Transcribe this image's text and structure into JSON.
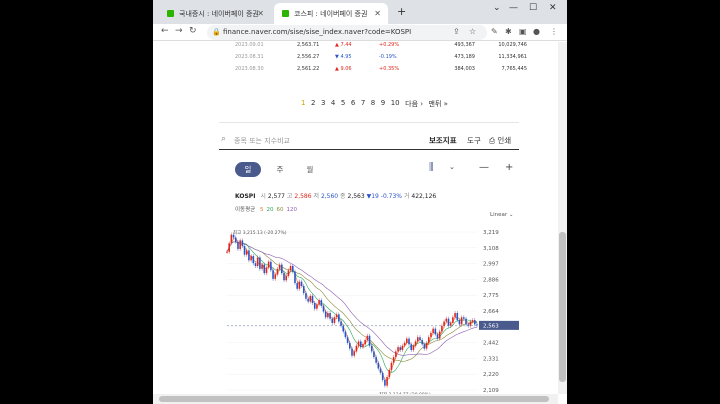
{
  "tabs": [
    {
      "label": "국내증시 : 네이버페이 증권"
    },
    {
      "label": "코스피 : 네이버페이 증권"
    }
  ],
  "url": "finance.naver.com/sise/sise_index.naver?code=KOSPI",
  "daily_rows": [
    {
      "date": "2023.09.01",
      "close": "2,563.71",
      "change": "7.44",
      "rate": "+0.29%",
      "volume": "493,367",
      "amount": "10,029,746",
      "dir": "up"
    },
    {
      "date": "2023.08.31",
      "close": "2,556.27",
      "change": "4.95",
      "rate": "-0.19%",
      "volume": "473,189",
      "amount": "11,334,961",
      "dir": "down"
    },
    {
      "date": "2023.08.30",
      "close": "2,561.22",
      "change": "9.06",
      "rate": "+0.35%",
      "volume": "384,003",
      "amount": "7,765,445",
      "dir": "up"
    }
  ],
  "pager": {
    "pages": [
      "1",
      "2",
      "3",
      "4",
      "5",
      "6",
      "7",
      "8",
      "9",
      "10"
    ],
    "next": "다음 ›",
    "last": "맨뒤 »"
  },
  "search": {
    "placeholder": "종목 또는 지수비교",
    "indicator": "보조지표",
    "tools": "도구",
    "print": "인쇄"
  },
  "periods": [
    "일",
    "주",
    "월"
  ],
  "quote": {
    "name": "KOSPI",
    "open_label": "시",
    "open": "2,577",
    "high_label": "고",
    "high": "2,586",
    "low_label": "저",
    "low": "2,560",
    "close_label": "종",
    "close": "2,563",
    "change": "▼19",
    "rate": "-0.73%",
    "vol_label": "거",
    "volume": "422,126"
  },
  "moving_avg": {
    "label": "이동평균",
    "periods": [
      "5",
      "20",
      "60",
      "120"
    ],
    "colors": [
      "#e07b39",
      "#2fa85a",
      "#8a8a3a",
      "#8e5fb4"
    ]
  },
  "scale_label": "Linear",
  "chart_data": {
    "type": "line",
    "y_ticks": [
      "3,219",
      "3,108",
      "2,997",
      "2,886",
      "2,775",
      "2,664",
      "2,553",
      "2,442",
      "2,331",
      "2,220",
      "2,109"
    ],
    "ylim": [
      2109,
      3219
    ],
    "last_value": "2,563",
    "annotations": {
      "high": "최고 3,215.13 (-20.27%)",
      "low": "최저 2,134.77 (20.08%)"
    },
    "series": [
      {
        "values": [
          3080,
          3140,
          3200,
          3180,
          3150,
          3100,
          3160,
          3120,
          3060,
          3090,
          3020,
          3050,
          3000,
          2980,
          3040,
          2960,
          2990,
          2930,
          2970,
          3010,
          2950,
          2890,
          2920,
          2960,
          2990,
          2930,
          2880,
          2910,
          2950,
          2980,
          2940,
          2860,
          2820,
          2870,
          2840,
          2790,
          2750,
          2730,
          2770,
          2720,
          2680,
          2710,
          2740,
          2700,
          2660,
          2620,
          2650,
          2610,
          2580,
          2620,
          2640,
          2590,
          2560,
          2520,
          2480,
          2440,
          2400,
          2350,
          2380,
          2420,
          2450,
          2410,
          2430,
          2460,
          2490,
          2420,
          2380,
          2340,
          2300,
          2260,
          2230,
          2180,
          2140,
          2200,
          2250,
          2300,
          2340,
          2380,
          2410,
          2390,
          2420,
          2440,
          2470,
          2430,
          2390,
          2420,
          2450,
          2480,
          2460,
          2430,
          2400,
          2440,
          2480,
          2510,
          2540,
          2500,
          2470,
          2520,
          2560,
          2590,
          2610,
          2560,
          2580,
          2620,
          2650,
          2600,
          2570,
          2620,
          2610,
          2570,
          2560,
          2590,
          2600,
          2570,
          2563
        ]
      }
    ]
  },
  "colors": {
    "up": "#e0271c",
    "down": "#2a55c9",
    "accent": "#4a5a8c"
  }
}
